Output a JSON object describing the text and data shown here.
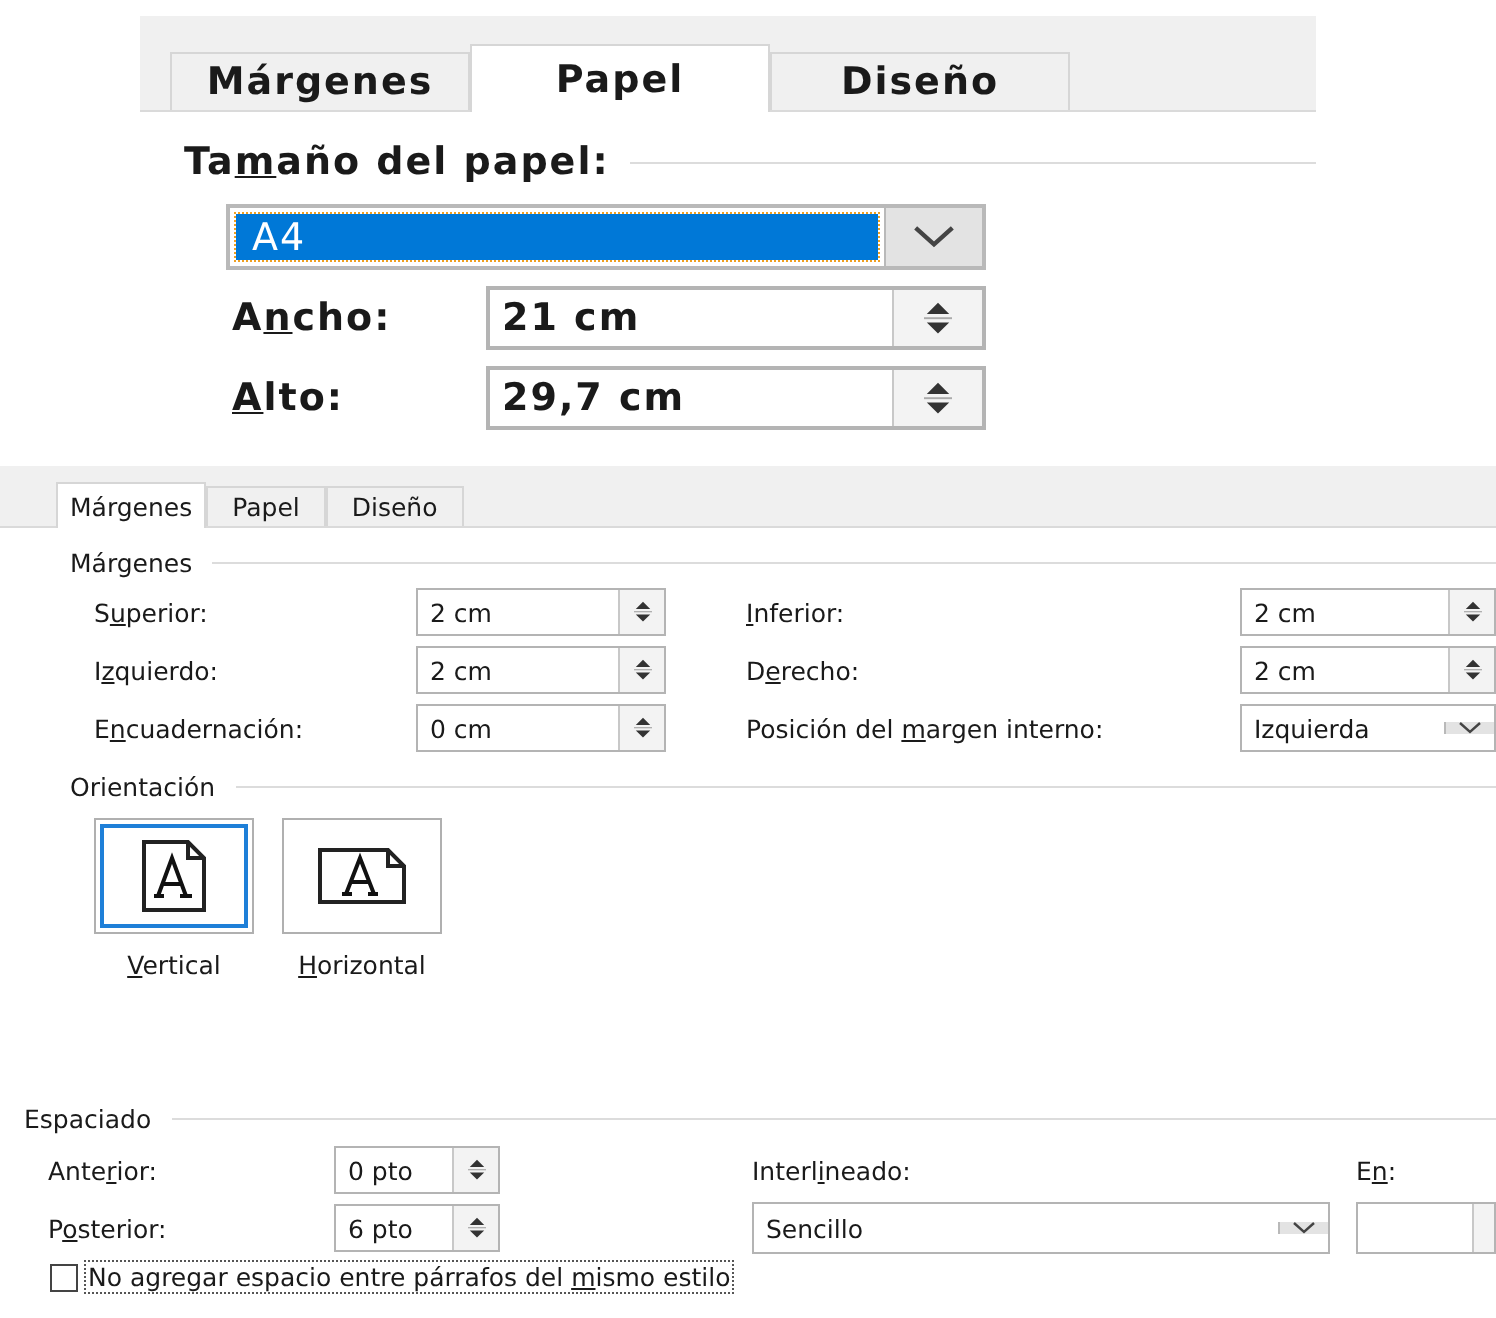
{
  "paper_panel": {
    "tabs": [
      {
        "label": "Márgenes",
        "selected": false
      },
      {
        "label": "Papel",
        "selected": true
      },
      {
        "label": "Diseño",
        "selected": false
      }
    ],
    "section": {
      "pre": "Ta",
      "key": "m",
      "post": "año del papel:"
    },
    "size": {
      "value": "A4",
      "selected": true
    },
    "fields": [
      {
        "label": {
          "pre": "A",
          "key": "n",
          "post": "cho:"
        },
        "value": "21 cm"
      },
      {
        "label": {
          "key": "A",
          "post": "lto:"
        },
        "value": "29,7 cm"
      }
    ]
  },
  "margins_panel": {
    "tabs": [
      {
        "label": "Márgenes",
        "selected": true
      },
      {
        "label": "Papel",
        "selected": false
      },
      {
        "label": "Diseño",
        "selected": false
      }
    ],
    "section": "Márgenes",
    "rows": [
      {
        "left": {
          "label": {
            "pre": "S",
            "key": "u",
            "post": "perior:"
          },
          "value": "2 cm",
          "kind": "spin"
        },
        "right": {
          "label": {
            "key": "I",
            "post": "nferior:"
          },
          "value": "2 cm",
          "kind": "spin"
        }
      },
      {
        "left": {
          "label": {
            "pre": "I",
            "key": "z",
            "post": "quierdo:"
          },
          "value": "2 cm",
          "kind": "spin"
        },
        "right": {
          "label": {
            "pre": "D",
            "key": "e",
            "post": "recho:"
          },
          "value": "2 cm",
          "kind": "spin"
        }
      },
      {
        "left": {
          "label": {
            "pre": "E",
            "key": "n",
            "post": "cuadernación:"
          },
          "value": "0 cm",
          "kind": "spin"
        },
        "right": {
          "label": {
            "pre": "Posición del ",
            "key": "m",
            "post": "argen interno:"
          },
          "value": "Izquierda",
          "kind": "select"
        }
      }
    ]
  },
  "orientation": {
    "section": "Orientación",
    "options": [
      {
        "label": {
          "key": "V",
          "post": "ertical"
        },
        "selected": true,
        "kind": "portrait"
      },
      {
        "label": {
          "key": "H",
          "post": "orizontal"
        },
        "selected": false,
        "kind": "landscape"
      }
    ]
  },
  "spacing": {
    "section": "Espaciado",
    "before": {
      "label": {
        "pre": "Ante",
        "key": "r",
        "post": "ior:"
      },
      "value": "0 pto"
    },
    "after": {
      "label": {
        "pre": "P",
        "key": "o",
        "post": "sterior:"
      },
      "value": "6 pto"
    },
    "line_spacing": {
      "label": {
        "pre": "Interl",
        "key": "i",
        "post": "neado:"
      },
      "value": "Sencillo"
    },
    "at": {
      "label": {
        "pre": "E",
        "key": "n",
        "post": ":"
      }
    },
    "checkbox": {
      "label": {
        "pre": "No agregar espacio entre párrafos del ",
        "key": "m",
        "post": "ismo estilo"
      },
      "checked": false
    }
  }
}
